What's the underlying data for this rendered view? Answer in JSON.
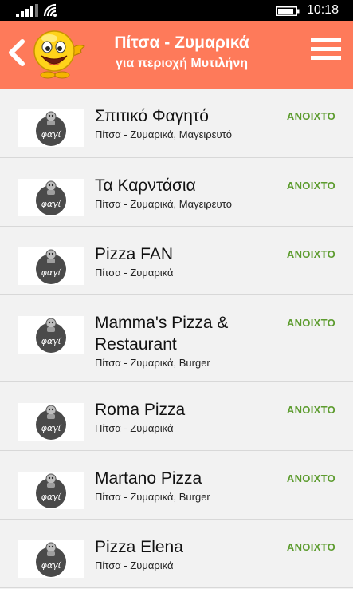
{
  "status_bar": {
    "time": "10:18",
    "signal_icon": "signal-bars-icon",
    "wifi_icon": "wifi-icon",
    "battery_icon": "battery-icon"
  },
  "header": {
    "title": "Πίτσα - Ζυμαρικά",
    "subtitle": "για περιοχή Μυτιλήνη",
    "back_icon": "chevron-left-icon",
    "menu_icon": "hamburger-menu-icon",
    "logo": "smiley-mascot-logo",
    "background_color": "#fe7a5a"
  },
  "list": {
    "status_color": "#5d9c2f",
    "thumb_logo_text": "φαγί",
    "items": [
      {
        "name": "Σπιτικό Φαγητό",
        "categories": "Πίτσα - Ζυμαρικά, Μαγειρευτό",
        "status": "ΑΝΟΙΧΤΟ"
      },
      {
        "name": "Τα Καρντάσια",
        "categories": "Πίτσα - Ζυμαρικά, Μαγειρευτό",
        "status": "ΑΝΟΙΧΤΟ"
      },
      {
        "name": "Pizza FAN",
        "categories": "Πίτσα - Ζυμαρικά",
        "status": "ΑΝΟΙΧΤΟ"
      },
      {
        "name": "Mamma's Pizza & Restaurant",
        "categories": "Πίτσα - Ζυμαρικά, Burger",
        "status": "ΑΝΟΙΧΤΟ"
      },
      {
        "name": "Roma Pizza",
        "categories": "Πίτσα - Ζυμαρικά",
        "status": "ΑΝΟΙΧΤΟ"
      },
      {
        "name": "Martano Pizza",
        "categories": "Πίτσα - Ζυμαρικά, Burger",
        "status": "ΑΝΟΙΧΤΟ"
      },
      {
        "name": "Pizza Elena",
        "categories": "Πίτσα - Ζυμαρικά",
        "status": "ΑΝΟΙΧΤΟ"
      }
    ]
  }
}
